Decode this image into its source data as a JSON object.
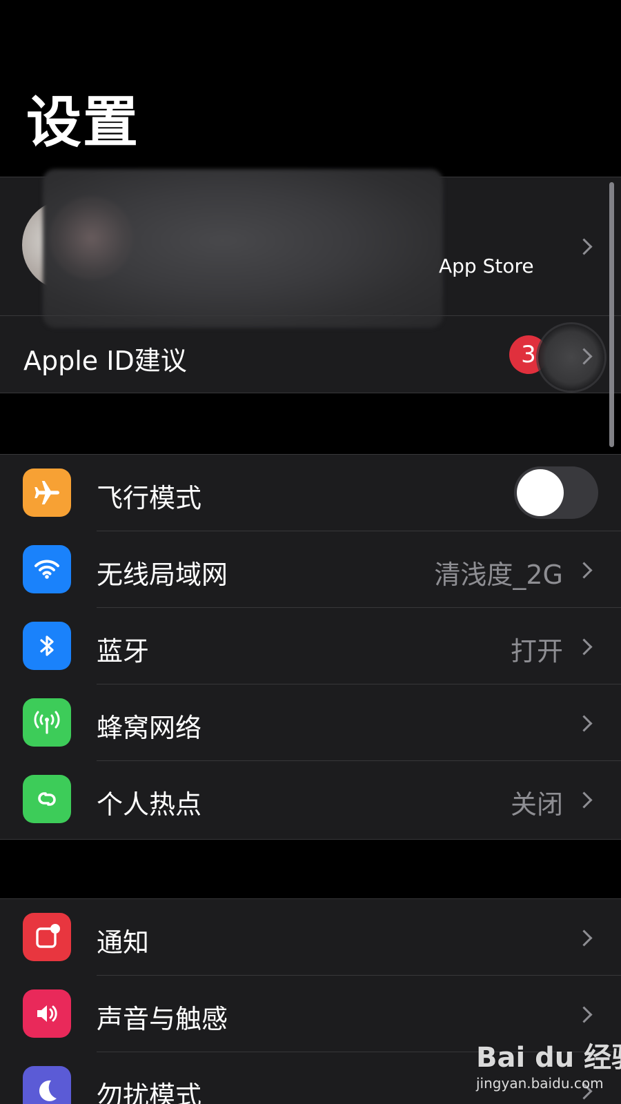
{
  "page": {
    "title": "设置"
  },
  "profile": {
    "subtitle_visible": "App Store",
    "suggestion_label": "Apple ID建议",
    "suggestion_badge": "3"
  },
  "network_items": [
    {
      "label": "飞行模式",
      "value": "",
      "icon": "airplane-icon",
      "color": "#f7a134",
      "toggle_on": false
    },
    {
      "label": "无线局域网",
      "value": "清浅度_2G",
      "icon": "wifi-icon",
      "color": "#1a82fb"
    },
    {
      "label": "蓝牙",
      "value": "打开",
      "icon": "bluetooth-icon",
      "color": "#1a82fb"
    },
    {
      "label": "蜂窝网络",
      "value": "",
      "icon": "cellular-antenna-icon",
      "color": "#3dcc59"
    },
    {
      "label": "个人热点",
      "value": "关闭",
      "icon": "hotspot-link-icon",
      "color": "#3dcc59"
    }
  ],
  "notify_items": [
    {
      "label": "通知",
      "icon": "notification-icon",
      "color": "#e8363f"
    },
    {
      "label": "声音与触感",
      "icon": "speaker-icon",
      "color": "#e9295a"
    },
    {
      "label": "勿扰模式",
      "icon": "moon-icon",
      "color": "#5b5bd6"
    }
  ],
  "watermark": {
    "logo": "Bai du 经验",
    "url": "jingyan.baidu.com"
  }
}
